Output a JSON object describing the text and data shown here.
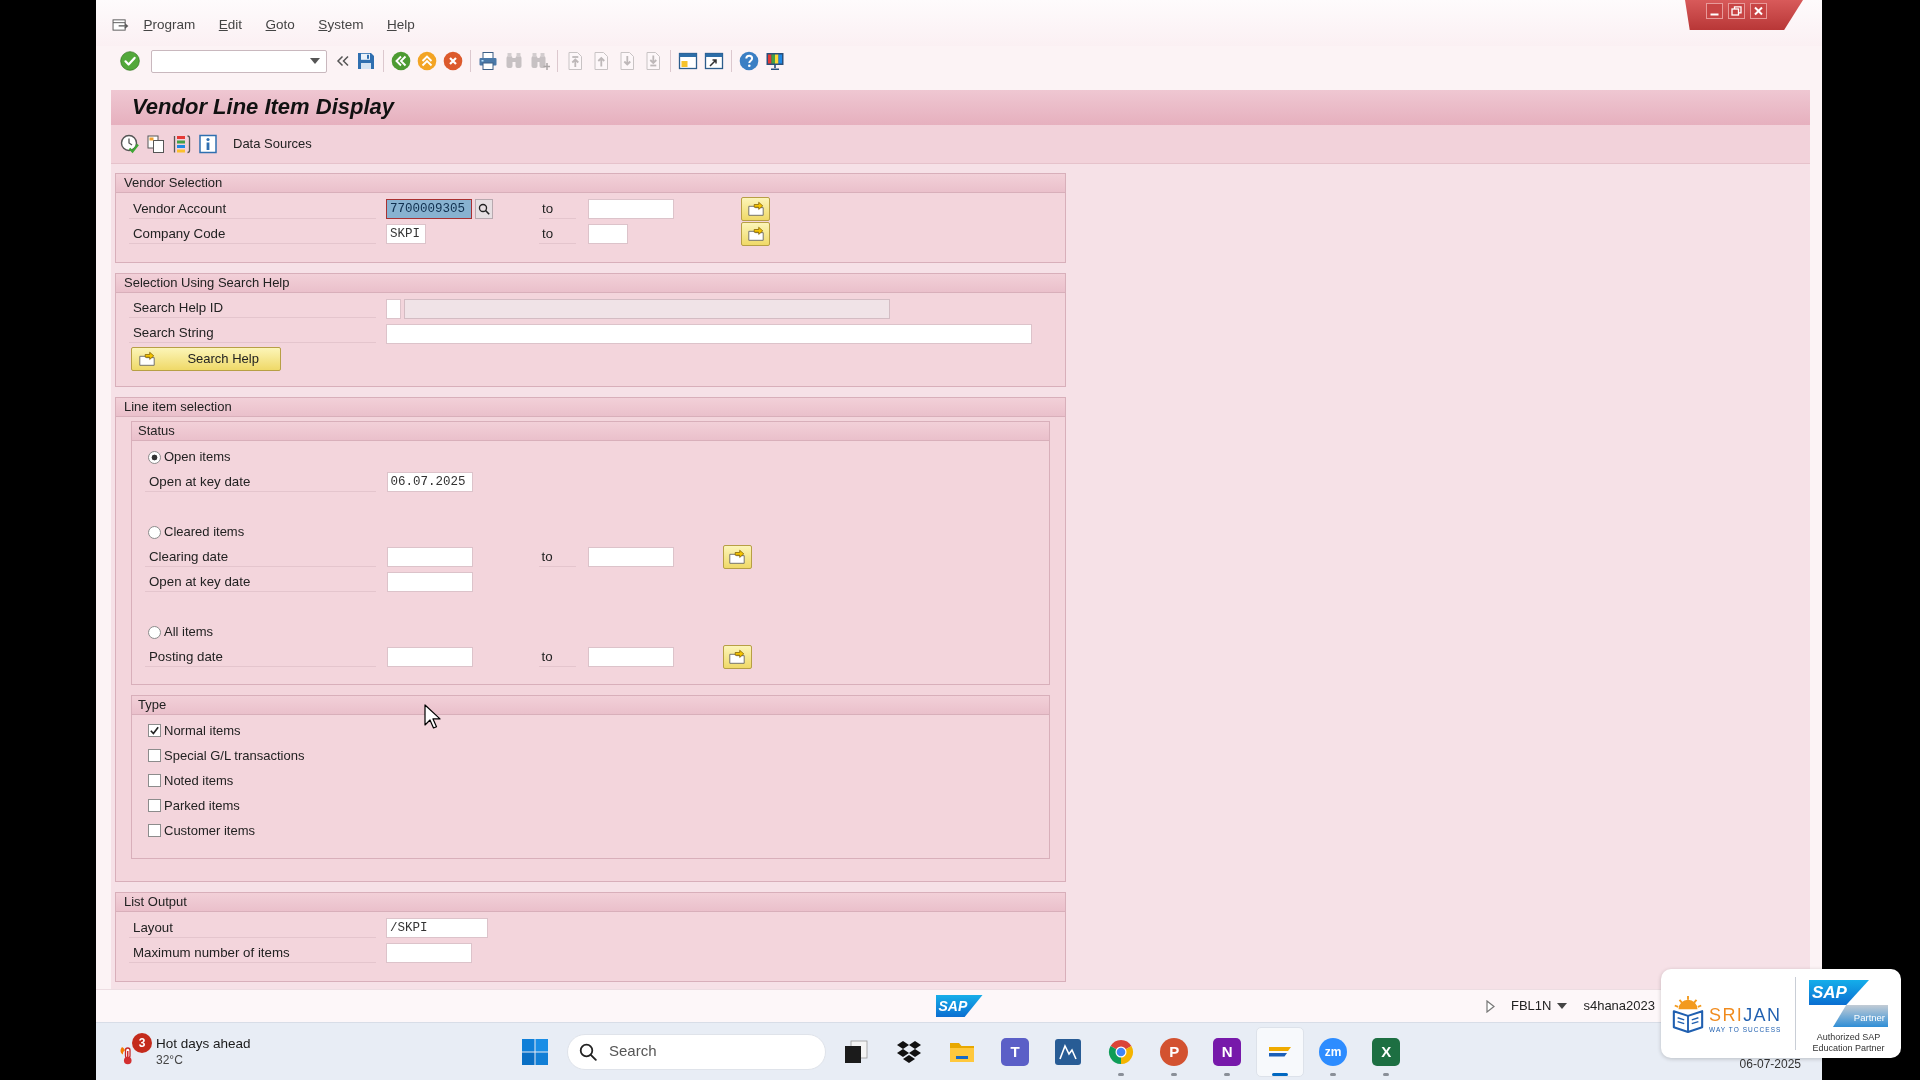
{
  "menu_bar": {
    "items": [
      "Program",
      "Edit",
      "Goto",
      "System",
      "Help"
    ]
  },
  "toolbar": {
    "items": [
      {
        "kind": "enter",
        "disabled": false
      },
      {
        "kind": "command-field"
      },
      {
        "kind": "collapse",
        "disabled": false
      },
      {
        "kind": "save",
        "disabled": false
      },
      {
        "kind": "separator"
      },
      {
        "kind": "back",
        "disabled": false
      },
      {
        "kind": "exit",
        "disabled": false
      },
      {
        "kind": "cancel",
        "disabled": false
      },
      {
        "kind": "separator"
      },
      {
        "kind": "print",
        "disabled": false
      },
      {
        "kind": "find",
        "disabled": true
      },
      {
        "kind": "find-next",
        "disabled": true
      },
      {
        "kind": "separator"
      },
      {
        "kind": "first-page",
        "disabled": true
      },
      {
        "kind": "previous-page",
        "disabled": true
      },
      {
        "kind": "next-page",
        "disabled": true
      },
      {
        "kind": "last-page",
        "disabled": true
      },
      {
        "kind": "separator"
      },
      {
        "kind": "new-session",
        "disabled": false
      },
      {
        "kind": "shortcut",
        "disabled": false
      },
      {
        "kind": "separator"
      },
      {
        "kind": "help",
        "disabled": false
      },
      {
        "kind": "layout",
        "disabled": false
      }
    ]
  },
  "title": "Vendor Line Item Display",
  "app_toolbar": {
    "items": [
      {
        "kind": "execute"
      },
      {
        "kind": "variant"
      },
      {
        "kind": "dynamic-selections"
      },
      {
        "kind": "info"
      },
      {
        "kind": "text",
        "label": "Data Sources"
      }
    ]
  },
  "vendor_selection": {
    "title": "Vendor Selection",
    "rows": [
      {
        "label": "Vendor Account",
        "value": "7700009305",
        "to_label": "to",
        "focused": true
      },
      {
        "label": "Company Code",
        "value": "SKPI",
        "to_label": "to",
        "focused": false
      }
    ]
  },
  "search_help": {
    "title": "Selection Using Search Help",
    "rows": [
      {
        "kind": "id",
        "label": "Search Help ID"
      },
      {
        "kind": "string",
        "label": "Search String"
      }
    ],
    "button": "Search Help"
  },
  "line_item_selection": {
    "title": "Line item selection",
    "status": {
      "title": "Status",
      "options": [
        {
          "label": "Open items",
          "selected": true,
          "fields": [
            {
              "label": "Open at key date",
              "value": "06.07.2025"
            }
          ]
        },
        {
          "label": "Cleared items",
          "selected": false,
          "fields": [
            {
              "label": "Clearing date",
              "to_label": "to"
            },
            {
              "label": "Open at key date"
            }
          ]
        },
        {
          "label": "All items",
          "selected": false,
          "fields": [
            {
              "label": "Posting date",
              "to_label": "to"
            }
          ]
        }
      ]
    },
    "type": {
      "title": "Type",
      "options": [
        {
          "label": "Normal items",
          "checked": true
        },
        {
          "label": "Special G/L transactions",
          "checked": false
        },
        {
          "label": "Noted items",
          "checked": false
        },
        {
          "label": "Parked items",
          "checked": false
        },
        {
          "label": "Customer items",
          "checked": false
        }
      ]
    }
  },
  "list_output": {
    "title": "List Output",
    "rows": [
      {
        "label": "Layout",
        "value": "/SKPI"
      },
      {
        "label": "Maximum number of items"
      }
    ]
  },
  "status_bar": {
    "logo": "SAP",
    "transaction": "FBL1N",
    "system": "s4hana2023"
  },
  "taskbar": {
    "weather": {
      "badge": "3",
      "title": "Hot days ahead",
      "temperature": "32°C"
    },
    "search": {
      "placeholder": "Search"
    },
    "apps": [
      {
        "kind": "taskview",
        "running": false,
        "active": false
      },
      {
        "kind": "boxes",
        "running": false,
        "active": false
      },
      {
        "kind": "folder",
        "running": false,
        "active": false
      },
      {
        "kind": "teams",
        "letter": "T",
        "running": false,
        "active": false
      },
      {
        "kind": "remote",
        "running": false,
        "active": false
      },
      {
        "kind": "browser",
        "running": true,
        "active": false
      },
      {
        "kind": "slides",
        "letter": "P",
        "running": true,
        "active": false
      },
      {
        "kind": "notes",
        "letter": "N",
        "running": true,
        "active": false
      },
      {
        "kind": "saplogon",
        "running": true,
        "active": true
      },
      {
        "kind": "meeting",
        "letter": "zm",
        "running": true,
        "active": false
      },
      {
        "kind": "sheet",
        "letter": "X",
        "running": true,
        "active": false
      }
    ],
    "date": "06-07-2025"
  },
  "partner_badge": {
    "brand": "SRIJAN",
    "tagline": "WAY TO SUCCESS",
    "partner_logo": "SAP",
    "partner_label": "Partner",
    "caption": "Authorized SAP Education Partner"
  }
}
